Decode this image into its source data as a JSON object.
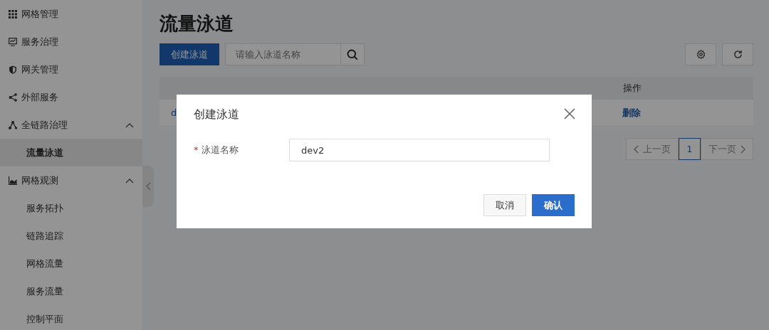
{
  "sidebar": {
    "items": [
      {
        "label": "网格管理",
        "kind": "grid",
        "selected": false
      },
      {
        "label": "服务治理",
        "kind": "monitor",
        "selected": false
      },
      {
        "label": "网关管理",
        "kind": "shield",
        "selected": false
      },
      {
        "label": "外部服务",
        "kind": "share",
        "selected": false
      },
      {
        "label": "全链路治理",
        "kind": "nodes",
        "selected": false,
        "expanded": true,
        "children": [
          {
            "label": "流量泳道",
            "selected": true
          }
        ]
      },
      {
        "label": "网格观测",
        "kind": "chart",
        "selected": false,
        "expanded": true,
        "children": [
          {
            "label": "服务拓扑",
            "selected": false
          },
          {
            "label": "链路追踪",
            "selected": false
          },
          {
            "label": "网格流量",
            "selected": false
          },
          {
            "label": "服务流量",
            "selected": false
          },
          {
            "label": "控制平面",
            "selected": false
          }
        ]
      }
    ]
  },
  "page": {
    "title": "流量泳道",
    "toolbar": {
      "create_button": "创建泳道",
      "search": {
        "placeholder": "请输入泳道名称"
      }
    },
    "table": {
      "columns": [
        "操作"
      ],
      "rows": [
        {
          "column_1": "d",
          "action": "删除"
        }
      ]
    },
    "pagination": {
      "prev": {
        "label": "上一页",
        "disabled": true
      },
      "pages": [
        {
          "label": "1",
          "selected": true
        }
      ],
      "next": {
        "label": "下一页",
        "disabled": true
      }
    }
  },
  "modal": {
    "title": "创建泳道",
    "field": {
      "required_mark": "*",
      "label": "泳道名称",
      "value": "dev2"
    },
    "buttons": [
      {
        "label": "取消",
        "kind": "secondary"
      },
      {
        "label": "确认",
        "kind": "primary"
      }
    ]
  }
}
